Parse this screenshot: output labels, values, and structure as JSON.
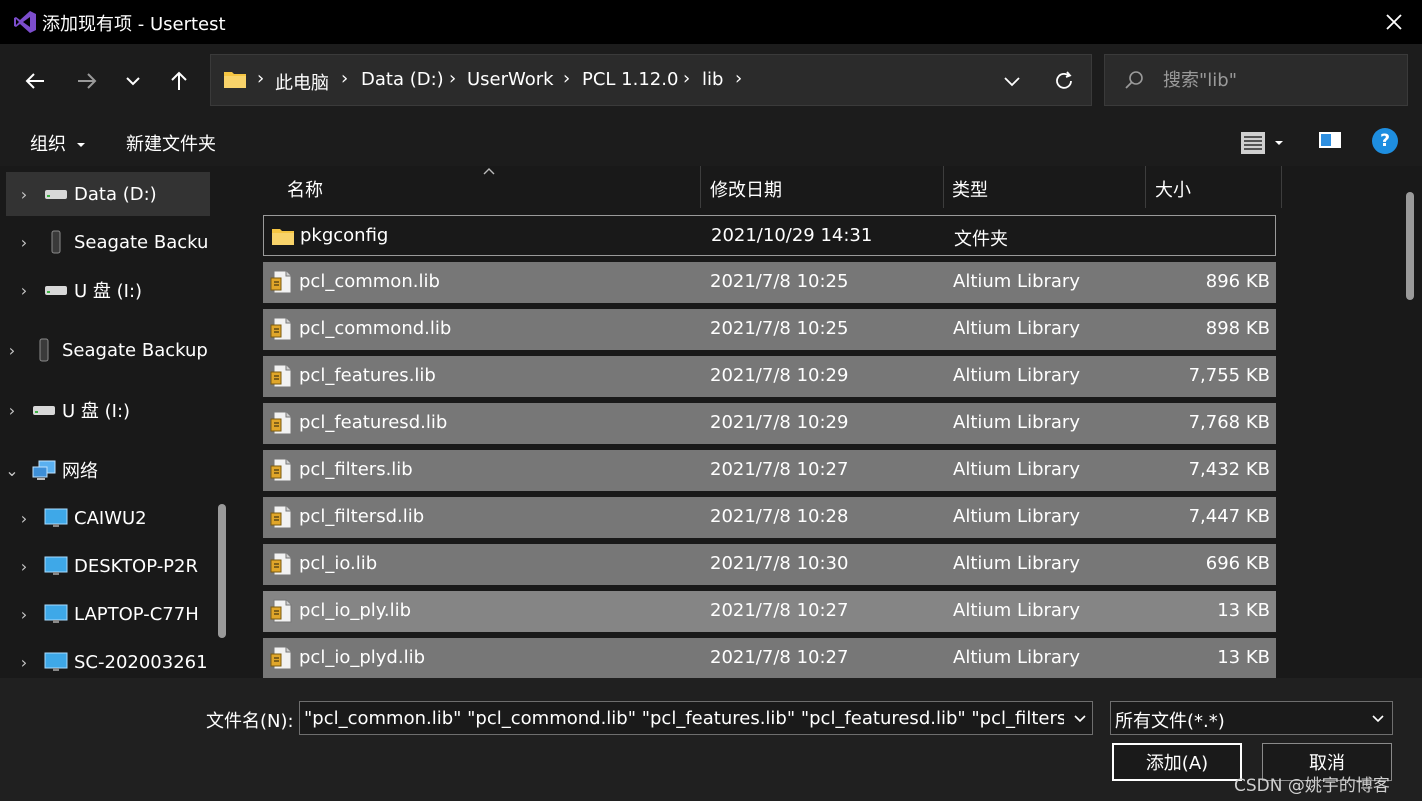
{
  "window": {
    "title": "添加现有项 - Usertest",
    "app_icon": "visual-studio-icon",
    "close_icon": "close-icon"
  },
  "nav": {
    "back_icon": "arrow-left-icon",
    "forward_icon": "arrow-right-icon",
    "recent_icon": "chevron-down-icon",
    "up_icon": "arrow-up-icon",
    "breadcrumbs": [
      "此电脑",
      "Data (D:)",
      "UserWork",
      "PCL 1.12.0",
      "lib"
    ],
    "refresh_icon": "refresh-icon",
    "search_placeholder": "搜索\"lib\""
  },
  "toolbar": {
    "organize": "组织",
    "new_folder": "新建文件夹",
    "help": "?"
  },
  "sidebar": {
    "items": [
      {
        "label": "Data (D:)",
        "icon": "drive-icon",
        "expand": "›"
      },
      {
        "label": "Seagate Backup",
        "icon": "external-drive-icon",
        "expand": "›"
      },
      {
        "label": "U 盘 (I:)",
        "icon": "drive-icon",
        "expand": "›"
      },
      {
        "label": "Seagate Backup",
        "icon": "external-drive-icon",
        "expand": "›"
      },
      {
        "label": "U 盘 (I:)",
        "icon": "drive-icon",
        "expand": "›"
      },
      {
        "label": "网络",
        "icon": "network-icon",
        "expand": "⌄"
      },
      {
        "label": "CAIWU2",
        "icon": "computer-icon",
        "expand": "›"
      },
      {
        "label": "DESKTOP-P2R",
        "icon": "computer-icon",
        "expand": "›"
      },
      {
        "label": "LAPTOP-C77H",
        "icon": "computer-icon",
        "expand": "›"
      },
      {
        "label": "SC-202003261",
        "icon": "computer-icon",
        "expand": "›"
      }
    ]
  },
  "columns": {
    "name": "名称",
    "modified": "修改日期",
    "type": "类型",
    "size": "大小"
  },
  "files": [
    {
      "name": "pkgconfig",
      "date": "2021/10/29 14:31",
      "type": "文件夹",
      "size": "",
      "icon": "folder-icon"
    },
    {
      "name": "pcl_common.lib",
      "date": "2021/7/8 10:25",
      "type": "Altium Library",
      "size": "896 KB",
      "icon": "library-file-icon"
    },
    {
      "name": "pcl_commond.lib",
      "date": "2021/7/8 10:25",
      "type": "Altium Library",
      "size": "898 KB",
      "icon": "library-file-icon"
    },
    {
      "name": "pcl_features.lib",
      "date": "2021/7/8 10:29",
      "type": "Altium Library",
      "size": "7,755 KB",
      "icon": "library-file-icon"
    },
    {
      "name": "pcl_featuresd.lib",
      "date": "2021/7/8 10:29",
      "type": "Altium Library",
      "size": "7,768 KB",
      "icon": "library-file-icon"
    },
    {
      "name": "pcl_filters.lib",
      "date": "2021/7/8 10:27",
      "type": "Altium Library",
      "size": "7,432 KB",
      "icon": "library-file-icon"
    },
    {
      "name": "pcl_filtersd.lib",
      "date": "2021/7/8 10:28",
      "type": "Altium Library",
      "size": "7,447 KB",
      "icon": "library-file-icon"
    },
    {
      "name": "pcl_io.lib",
      "date": "2021/7/8 10:30",
      "type": "Altium Library",
      "size": "696 KB",
      "icon": "library-file-icon"
    },
    {
      "name": "pcl_io_ply.lib",
      "date": "2021/7/8 10:27",
      "type": "Altium Library",
      "size": "13 KB",
      "icon": "library-file-icon"
    },
    {
      "name": "pcl_io_plyd.lib",
      "date": "2021/7/8 10:27",
      "type": "Altium Library",
      "size": "13 KB",
      "icon": "library-file-icon"
    }
  ],
  "footer": {
    "filename_label": "文件名(N):",
    "filename_value": "\"pcl_common.lib\" \"pcl_commond.lib\" \"pcl_features.lib\" \"pcl_featuresd.lib\" \"pcl_filters.lib\"",
    "filter_value": "所有文件(*.*)",
    "add_button": "添加(A)",
    "cancel_button": "取消",
    "watermark": "CSDN @姚宇的博客"
  },
  "colors": {
    "window_bg": "#191919",
    "titlebar": "#000000",
    "selected_row": "#777777",
    "accent_help": "#1e8ee0",
    "folder": "#f5c542"
  }
}
